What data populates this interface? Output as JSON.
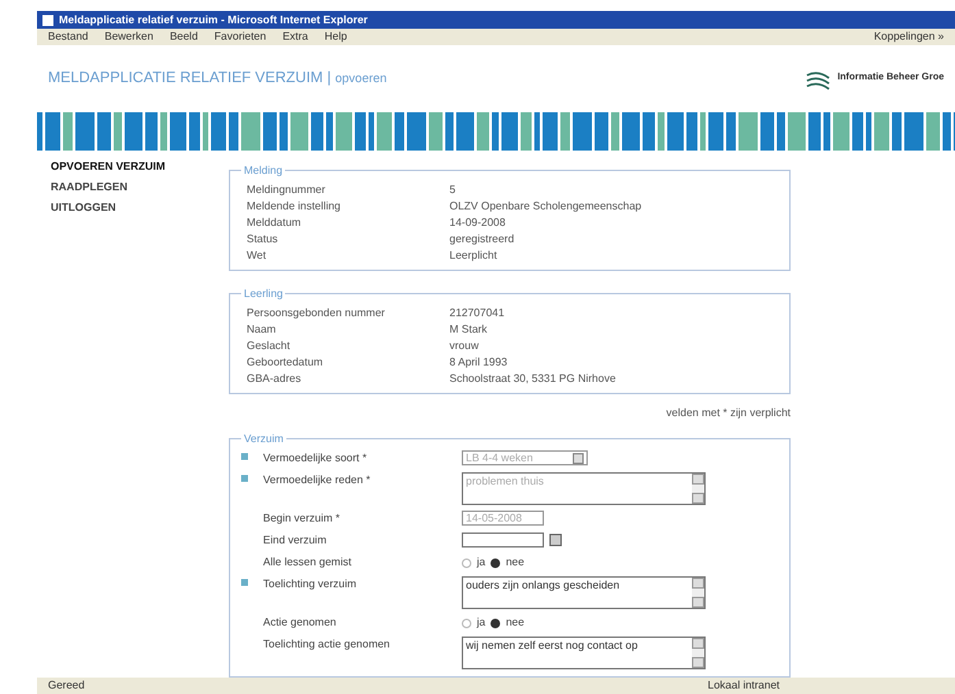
{
  "window": {
    "title": "Meldapplicatie relatief verzuim - Microsoft Internet Explorer"
  },
  "menu": [
    "Bestand",
    "Bewerken",
    "Beeld",
    "Favorieten",
    "Extra",
    "Help"
  ],
  "links_label": "Koppelingen »",
  "header": {
    "title": "MELDAPPLICATIE RELATIEF VERZUIM",
    "separator": "|",
    "subtitle": "opvoeren",
    "logo_text": "Informatie Beheer Groe"
  },
  "nav": [
    {
      "label": "OPVOEREN VERZUIM",
      "selected": true
    },
    {
      "label": "RAADPLEGEN",
      "selected": false
    },
    {
      "label": "UITLOGGEN",
      "selected": false
    }
  ],
  "melding": {
    "legend": "Melding",
    "rows": [
      {
        "label": "Meldingnummer",
        "value": "5"
      },
      {
        "label": "Meldende instelling",
        "value": "OLZV Openbare Scholengemeenschap"
      },
      {
        "label": "Melddatum",
        "value": "14-09-2008"
      },
      {
        "label": "Status",
        "value": "geregistreerd"
      },
      {
        "label": "Wet",
        "value": "Leerplicht"
      }
    ]
  },
  "leerling": {
    "legend": "Leerling",
    "rows": [
      {
        "label": "Persoonsgebonden nummer",
        "value": "212707041"
      },
      {
        "label": "Naam",
        "value": "M Stark"
      },
      {
        "label": "Geslacht",
        "value": "vrouw"
      },
      {
        "label": "Geboortedatum",
        "value": "8 April 1993"
      },
      {
        "label": "GBA-adres",
        "value": "Schoolstraat 30, 5331 PG Nirhove"
      }
    ]
  },
  "required_note": "velden met * zijn verplicht",
  "verzuim": {
    "legend": "Verzuim",
    "rows": [
      {
        "kind": "select",
        "marked": true,
        "disabled": true,
        "label": "Vermoedelijke soort *",
        "value": "LB 4-4 weken"
      },
      {
        "kind": "textarea",
        "marked": true,
        "disabled": true,
        "label": "Vermoedelijke reden *",
        "value": "problemen thuis"
      },
      {
        "kind": "input",
        "marked": false,
        "disabled": true,
        "label": "Begin verzuim *",
        "value": "14-05-2008"
      },
      {
        "kind": "date",
        "marked": false,
        "label": "Eind verzuim"
      },
      {
        "kind": "radio",
        "marked": false,
        "label": "Alle lessen gemist",
        "options": [
          {
            "label": "ja",
            "selected": false
          },
          {
            "label": "nee",
            "selected": true
          }
        ]
      },
      {
        "kind": "textarea",
        "marked": true,
        "label": "Toelichting verzuim",
        "value": "ouders zijn onlangs gescheiden"
      },
      {
        "kind": "radio",
        "marked": false,
        "label": "Actie genomen",
        "options": [
          {
            "label": "ja",
            "selected": false
          },
          {
            "label": "nee",
            "selected": true
          }
        ]
      },
      {
        "kind": "textarea",
        "marked": false,
        "label": "Toelichting actie genomen",
        "value": "wij nemen zelf eerst nog contact op"
      }
    ]
  },
  "status_bar": {
    "left": "Gereed",
    "right": "Lokaal intranet"
  }
}
